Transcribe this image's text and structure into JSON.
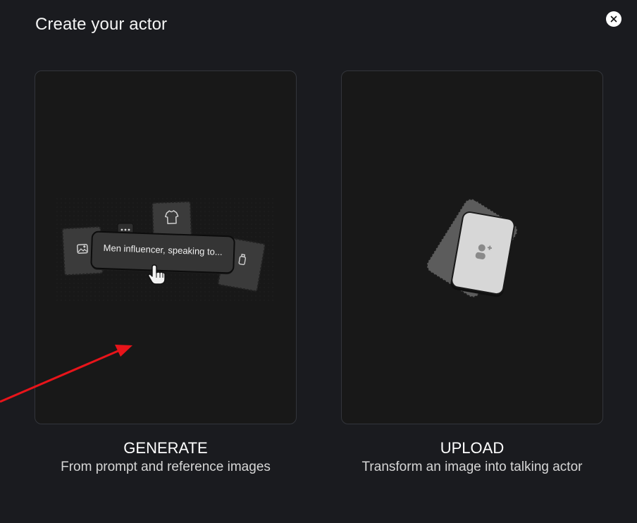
{
  "dialog": {
    "title": "Create your actor"
  },
  "options": [
    {
      "title": "GENERATE",
      "subtitle": "From prompt and reference images",
      "illustration": {
        "prompt_text": "Men influencer, speaking to...",
        "icons": [
          "image-icon",
          "shirt-icon",
          "bottle-icon",
          "chat-icon",
          "pointer-hand-icon"
        ]
      }
    },
    {
      "title": "UPLOAD",
      "subtitle": "Transform an image into talking actor",
      "illustration": {
        "icons": [
          "add-user-icon"
        ]
      }
    }
  ],
  "colors": {
    "background": "#1a1b1f",
    "card": "#181818",
    "card_border": "#33353b",
    "annotation_arrow": "#e8141a"
  }
}
